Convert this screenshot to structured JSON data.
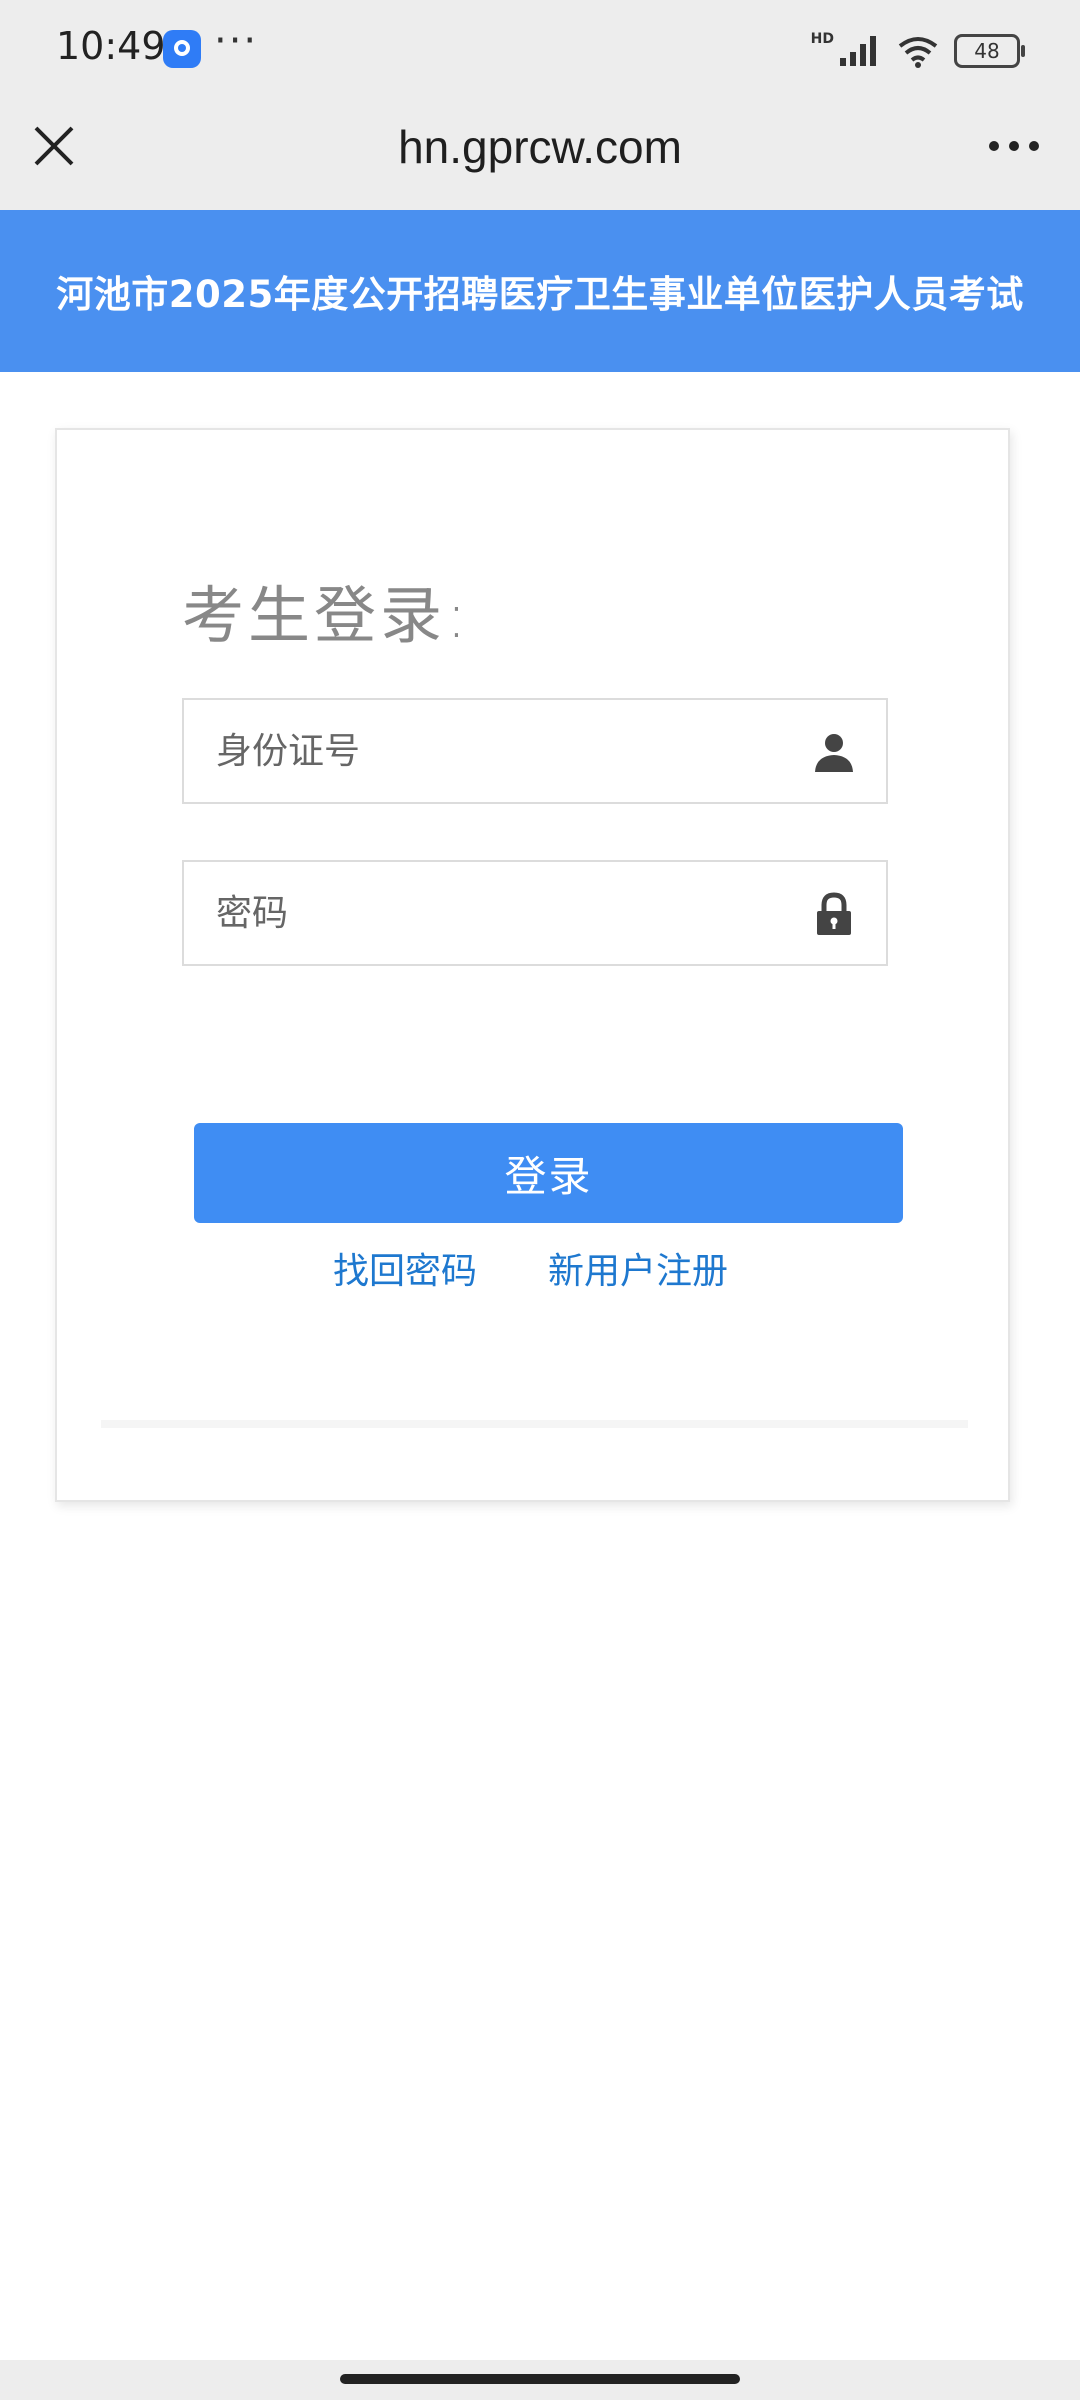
{
  "status_bar": {
    "time": "10:49",
    "more": "···",
    "network": "HD",
    "battery": "48",
    "icons": [
      "qq-browser-app-icon",
      "signal-icon",
      "wifi-icon",
      "battery-icon"
    ]
  },
  "browser": {
    "title": "hn.gprcw.com",
    "close_icon": "close-icon",
    "menu_icon": "more-icon"
  },
  "banner": {
    "title": "河池市2025年度公开招聘医疗卫生事业单位医护人员考试"
  },
  "login": {
    "title": "考生登录:",
    "id_field": {
      "placeholder": "身份证号",
      "value": "",
      "icon": "user-icon"
    },
    "password_field": {
      "placeholder": "密码",
      "value": "",
      "icon": "lock-icon"
    },
    "submit_label": "登录",
    "forgot_label": "找回密码",
    "register_label": "新用户注册"
  },
  "colors": {
    "banner": "#4a90f0",
    "button": "#3f8df3",
    "link": "#1e78cf"
  }
}
